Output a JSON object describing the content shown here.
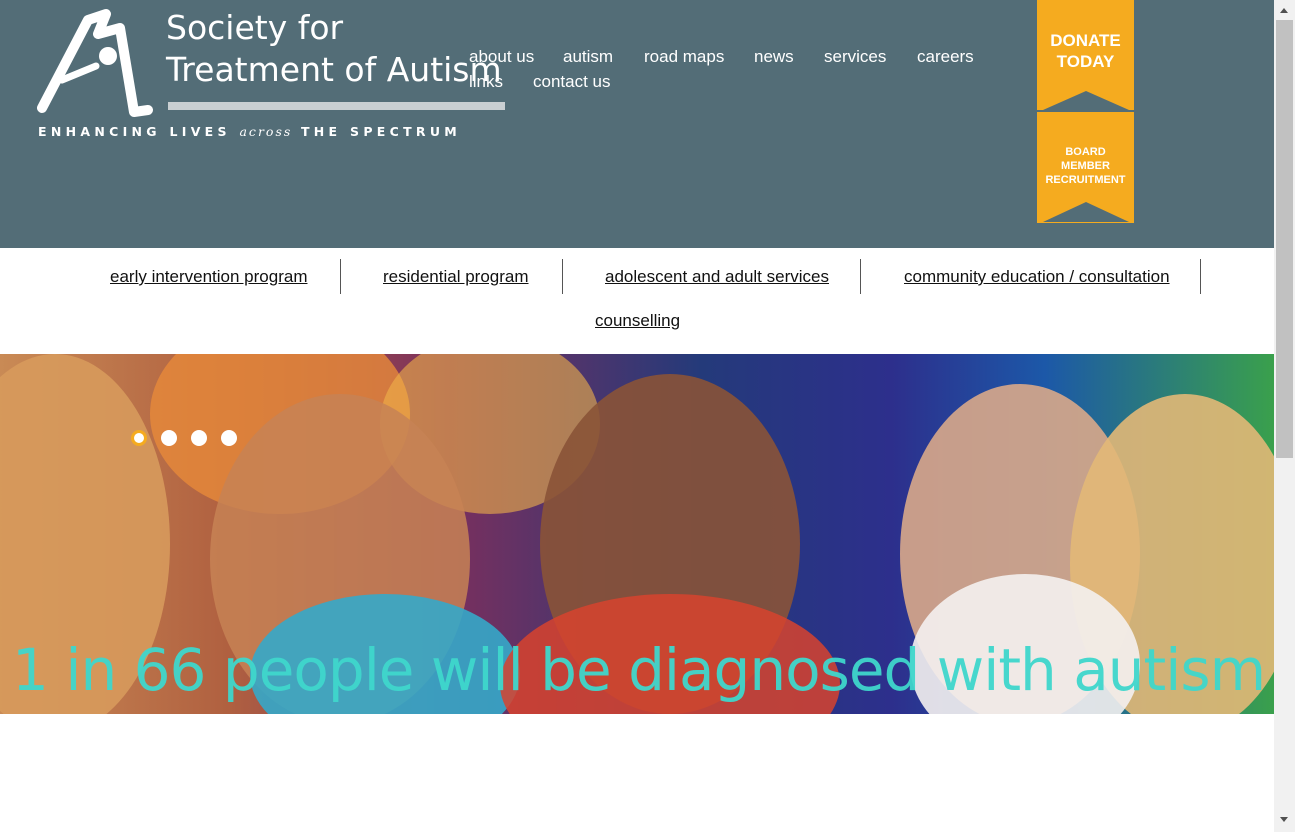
{
  "logo": {
    "line1": "Society for",
    "line2": "Treatment of Autism",
    "tagline_pre": "ENHANCING LIVES",
    "tagline_mid": "across",
    "tagline_post": "THE SPECTRUM"
  },
  "topnav": [
    "about us",
    "autism",
    "road maps",
    "news",
    "services",
    "careers",
    "links",
    "contact us"
  ],
  "donate": {
    "label_line1": "DONATE",
    "label_line2": "TODAY"
  },
  "board": {
    "line1": "BOARD",
    "line2": "MEMBER",
    "line3": "RECRUITMENT"
  },
  "subnav": [
    "early intervention program",
    "residential program",
    "adolescent and adult services",
    "community education / consultation",
    "counselling"
  ],
  "hero": {
    "caption": "1 in 66 people will be diagnosed with autism",
    "slides_total": 4,
    "active_slide": 1
  },
  "colors": {
    "header_bg": "#536d77",
    "accent": "#f5ab1f",
    "caption": "#3fd7cc"
  }
}
